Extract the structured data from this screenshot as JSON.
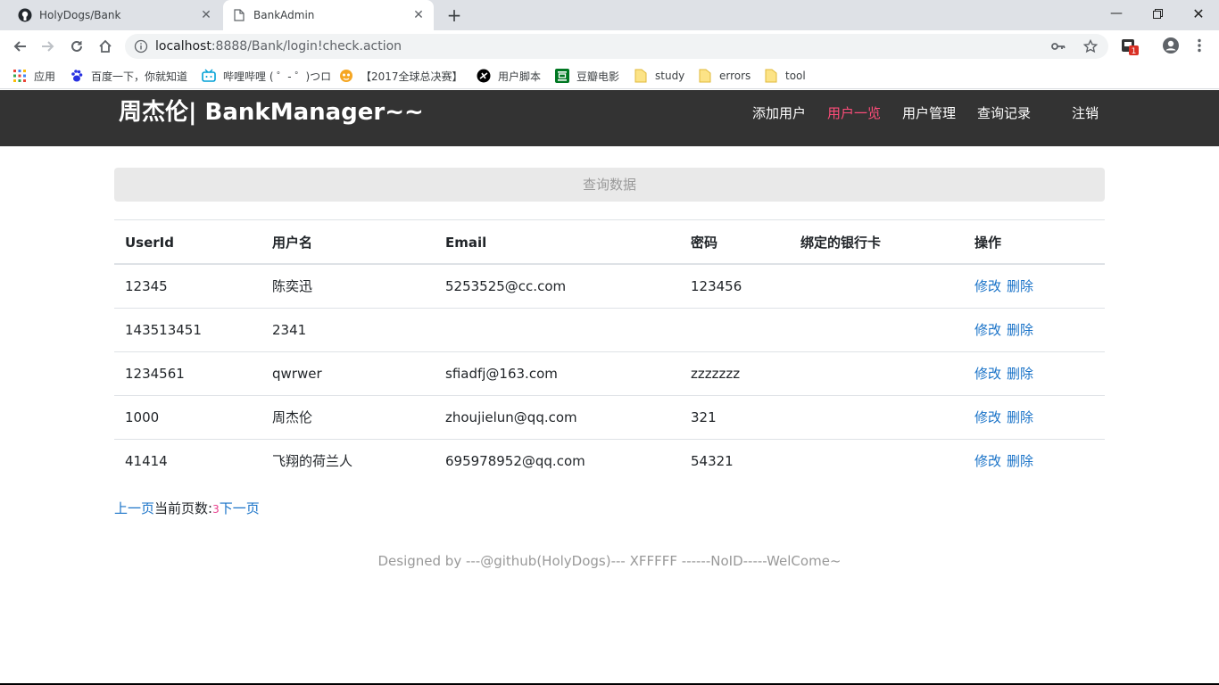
{
  "browser": {
    "tabs": [
      {
        "title": "HolyDogs/Bank",
        "active": false,
        "icon": "github-icon"
      },
      {
        "title": "BankAdmin",
        "active": true,
        "icon": "page-icon"
      }
    ],
    "url_host": "localhost",
    "url_rest": ":8888/Bank/login!check.action",
    "badge_count": "1",
    "bookmarks": [
      {
        "label": "应用",
        "icon": "apps-grid-icon"
      },
      {
        "label": "百度一下，你就知道",
        "icon": "baidu-paw-icon"
      },
      {
        "label": "哔哩哔哩 ( ゜- ゜)つロ",
        "icon": "bilibili-tv-icon"
      },
      {
        "label": "【2017全球总决赛】",
        "icon": "game-icon"
      },
      {
        "label": "用户脚本",
        "icon": "userscript-icon"
      },
      {
        "label": "豆瓣电影",
        "icon": "douban-icon"
      },
      {
        "label": "study",
        "icon": "folder-icon"
      },
      {
        "label": "errors",
        "icon": "folder-icon"
      },
      {
        "label": "tool",
        "icon": "folder-icon"
      }
    ]
  },
  "header": {
    "brand": "周杰伦| BankManager~~",
    "nav": [
      "添加用户",
      "用户一览",
      "用户管理",
      "查询记录",
      "注销"
    ],
    "active_index": 1
  },
  "query_button": "查询数据",
  "table": {
    "columns": [
      "UserId",
      "用户名",
      "Email",
      "密码",
      "绑定的银行卡",
      "操作"
    ],
    "rows": [
      {
        "id": "12345",
        "name": "陈奕迅",
        "email": "5253525@cc.com",
        "password": "123456",
        "card": "",
        "edit": "修改",
        "delete": "删除"
      },
      {
        "id": "143513451",
        "name": "2341",
        "email": "",
        "password": "",
        "card": "",
        "edit": "修改",
        "delete": "删除"
      },
      {
        "id": "1234561",
        "name": "qwrwer",
        "email": "sfiadfj@163.com",
        "password": "zzzzzzz",
        "card": "",
        "edit": "修改",
        "delete": "删除"
      },
      {
        "id": "1000",
        "name": "周杰伦",
        "email": "zhoujielun@qq.com",
        "password": "321",
        "card": "",
        "edit": "修改",
        "delete": "删除"
      },
      {
        "id": "41414",
        "name": "飞翔的荷兰人",
        "email": "695978952@qq.com",
        "password": "54321",
        "card": "",
        "edit": "修改",
        "delete": "删除"
      }
    ]
  },
  "pager": {
    "prev": "上一页",
    "label": "当前页数:",
    "page": "3",
    "next": "下一页"
  },
  "footer": "Designed by ---@github(HolyDogs)--- XFFFFF ------NoID-----WelCome~",
  "colors": {
    "navbar": "#333333",
    "active_nav": "#ff4d7a",
    "link": "#1a73c8",
    "page_number": "#e83e8c"
  }
}
